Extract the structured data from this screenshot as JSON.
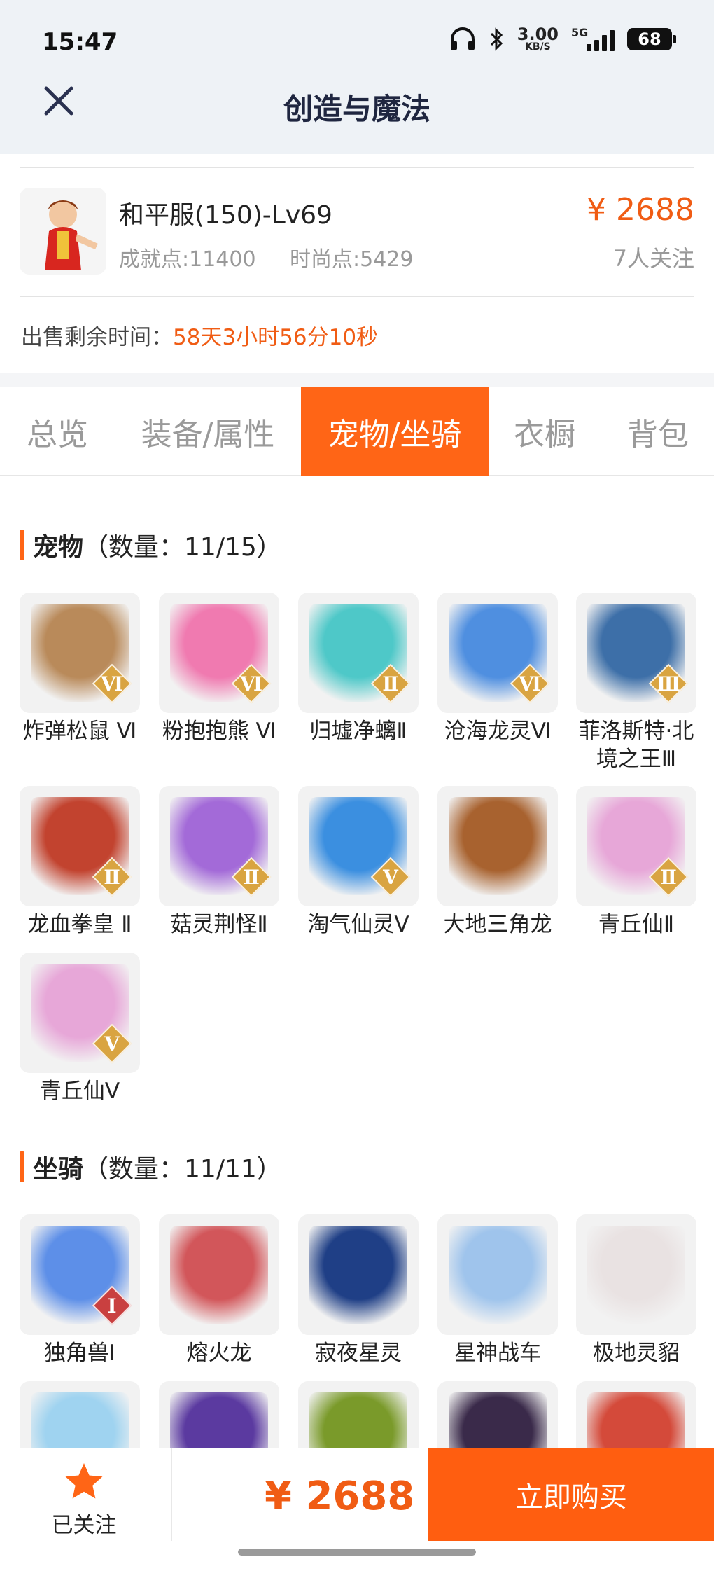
{
  "status_bar": {
    "time": "15:47",
    "net_speed": "3.00",
    "net_unit": "KB/S",
    "network": "5G",
    "battery": "68"
  },
  "header": {
    "title": "创造与魔法"
  },
  "item": {
    "name": "和平服(150)-Lv69",
    "achievement": "成就点:11400",
    "fashion": "时尚点:5429",
    "price": "¥ 2688",
    "followers": "7人关注",
    "remain_label": "出售剩余时间：",
    "remain_value": "58天3小时56分10秒"
  },
  "tabs": [
    "总览",
    "装备/属性",
    "宠物/坐骑",
    "衣橱",
    "背包"
  ],
  "active_tab": 2,
  "pets": {
    "title_bold": "宠物",
    "title_rest": "（数量：11/15）",
    "items": [
      {
        "label": "炸弹松鼠 Ⅵ",
        "rank": "Ⅵ",
        "color": "#b98a5a"
      },
      {
        "label": "粉抱抱熊 Ⅵ",
        "rank": "Ⅵ",
        "color": "#f07ab0"
      },
      {
        "label": "归墟净螭Ⅱ",
        "rank": "Ⅱ",
        "color": "#4ec8c8"
      },
      {
        "label": "沧海龙灵Ⅵ",
        "rank": "Ⅵ",
        "color": "#4f8fe0"
      },
      {
        "label": "菲洛斯特·北境之王Ⅲ",
        "rank": "Ⅲ",
        "color": "#3d6fa8"
      },
      {
        "label": "龙血拳皇 Ⅱ",
        "rank": "Ⅱ",
        "color": "#c2432f"
      },
      {
        "label": "菇灵荆怪Ⅱ",
        "rank": "Ⅱ",
        "color": "#a36ad8"
      },
      {
        "label": "淘气仙灵Ⅴ",
        "rank": "Ⅴ",
        "color": "#3b8fe0"
      },
      {
        "label": "大地三角龙",
        "rank": "",
        "color": "#a8622f"
      },
      {
        "label": "青丘仙Ⅱ",
        "rank": "Ⅱ",
        "color": "#e7a7d8"
      },
      {
        "label": "青丘仙Ⅴ",
        "rank": "Ⅴ",
        "color": "#e7a7d8"
      }
    ]
  },
  "mounts": {
    "title_bold": "坐骑",
    "title_rest": "（数量：11/11）",
    "items": [
      {
        "label": "独角兽Ⅰ",
        "rank": "Ⅰ",
        "color": "#5d8fe8"
      },
      {
        "label": "熔火龙",
        "rank": "",
        "color": "#d2565a"
      },
      {
        "label": "寂夜星灵",
        "rank": "",
        "color": "#1f3f86"
      },
      {
        "label": "星神战车",
        "rank": "",
        "color": "#9fc4ec"
      },
      {
        "label": "极地灵貂",
        "rank": "",
        "color": "#e9e2e2"
      }
    ],
    "partial_colors": [
      "#9fd3f0",
      "#5b3aa0",
      "#7a9a2a",
      "#3a2a4a",
      "#d44a3a"
    ]
  },
  "bottom_bar": {
    "follow_label": "已关注",
    "price": "¥ 2688",
    "buy_label": "立即购买"
  }
}
